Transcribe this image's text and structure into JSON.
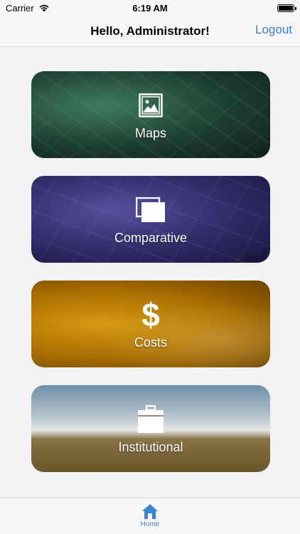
{
  "status_bar": {
    "carrier": "Carrier",
    "time": "6:19 AM"
  },
  "nav": {
    "title": "Hello, Administrator!",
    "logout_label": "Logout"
  },
  "cards": [
    {
      "label": "Maps",
      "icon": "image-icon"
    },
    {
      "label": "Comparative",
      "icon": "copy-icon"
    },
    {
      "label": "Costs",
      "icon": "dollar-icon"
    },
    {
      "label": "Institutional",
      "icon": "briefcase-icon"
    }
  ],
  "tab_bar": {
    "items": [
      {
        "label": "Home",
        "icon": "home-icon",
        "active": true
      }
    ]
  },
  "colors": {
    "accent": "#3b82d6"
  }
}
